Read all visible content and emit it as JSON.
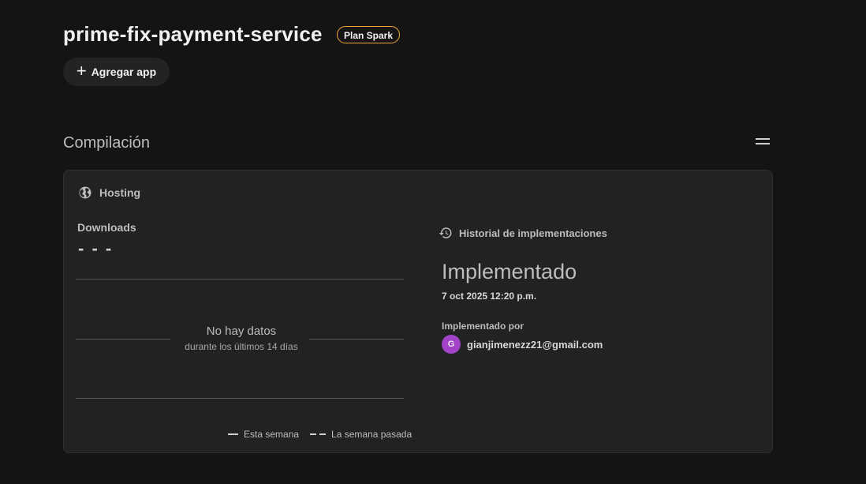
{
  "header": {
    "project_name": "prime-fix-payment-service",
    "plan_badge": "Plan Spark",
    "add_app_label": "Agregar app"
  },
  "section": {
    "title": "Compilación"
  },
  "hosting_card": {
    "title": "Hosting",
    "downloads": {
      "label": "Downloads",
      "value": "- - -",
      "empty_title": "No hay datos",
      "empty_subtitle": "durante los últimos 14 días",
      "legend": [
        "Esta semana",
        "La semana pasada"
      ]
    },
    "history": {
      "title": "Historial de implementaciones",
      "status": "Implementado",
      "date": "7 oct 2025 12:20 p.m.",
      "deployed_by_label": "Implementado por",
      "deployer_initial": "G",
      "deployer_email": "gianjimenezz21@gmail.com"
    }
  },
  "colors": {
    "badge_border": "#f2a93b",
    "avatar_bg": "#a142c9"
  },
  "icons": [
    "plus-icon",
    "menu-icon",
    "globe-icon",
    "history-icon"
  ]
}
